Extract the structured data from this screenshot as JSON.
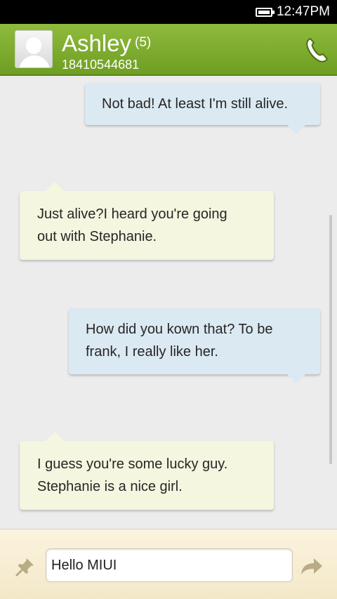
{
  "status_bar": {
    "time": "12:47PM"
  },
  "header": {
    "name": "Ashley",
    "unread": "(5)",
    "number": "18410544681"
  },
  "messages": [
    {
      "direction": "out",
      "text": "Not bad! At least I'm still alive."
    },
    {
      "direction": "in",
      "line1": "Just  alive?I heard you're going",
      "line2": "out with Stephanie."
    },
    {
      "direction": "out",
      "line1": "How did you kown that? To be",
      "line2": "frank, I really like her."
    },
    {
      "direction": "in",
      "line1": "I guess you're some lucky guy.",
      "line2": "Stephanie is a nice girl."
    }
  ],
  "composer": {
    "value": "Hello MIUI"
  },
  "icons": {
    "battery": "battery-icon",
    "avatar": "contact-avatar",
    "call": "phone-icon",
    "attach": "pin-icon",
    "send": "send-arrow-icon"
  },
  "colors": {
    "header": "#7aa82b",
    "outgoing_bubble": "#dbe9f2",
    "incoming_bubble": "#f4f6df",
    "composer_bar": "#f7eed5"
  }
}
